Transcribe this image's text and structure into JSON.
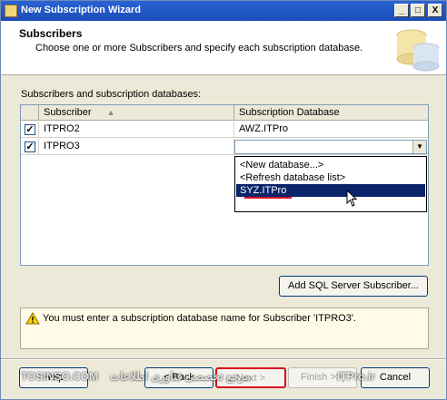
{
  "window": {
    "title": "New Subscription Wizard"
  },
  "titlebar_buttons": {
    "minimize": "_",
    "maximize": "□",
    "close": "X"
  },
  "header": {
    "title": "Subscribers",
    "description": "Choose one or more Subscribers and specify each subscription database."
  },
  "grid": {
    "label": "Subscribers and subscription databases:",
    "columns": [
      "Subscriber",
      "Subscription Database"
    ],
    "sort_indicator": "▲",
    "rows": [
      {
        "checked": "✓",
        "subscriber": "ITPRO2",
        "database": "AWZ.ITPro"
      },
      {
        "checked": "✓",
        "subscriber": "ITPRO3",
        "database": ""
      }
    ],
    "dropdown_arrow": "▼",
    "dropdown_options": [
      "<New database...>",
      "<Refresh database list>",
      "SYZ.ITPro"
    ],
    "dropdown_selected_index": 2
  },
  "add_subscriber_button": "Add SQL Server Subscriber...",
  "message": {
    "text": "You must enter a subscription database name for Subscriber 'ITPRO3'."
  },
  "nav_buttons": {
    "help": "Help",
    "back": "< Back",
    "next": "Next >",
    "finish": "Finish >>|",
    "cancel": "Cancel"
  },
  "watermark": {
    "left": "TOSINSO.COM",
    "middle": "مرجع تخصصی فناوری اطلاعات",
    "right": "ITPro.ir"
  },
  "colors": {
    "titlebar": "#2a63d4",
    "selection": "#0a246a",
    "highlight_red": "#d40f1e"
  }
}
